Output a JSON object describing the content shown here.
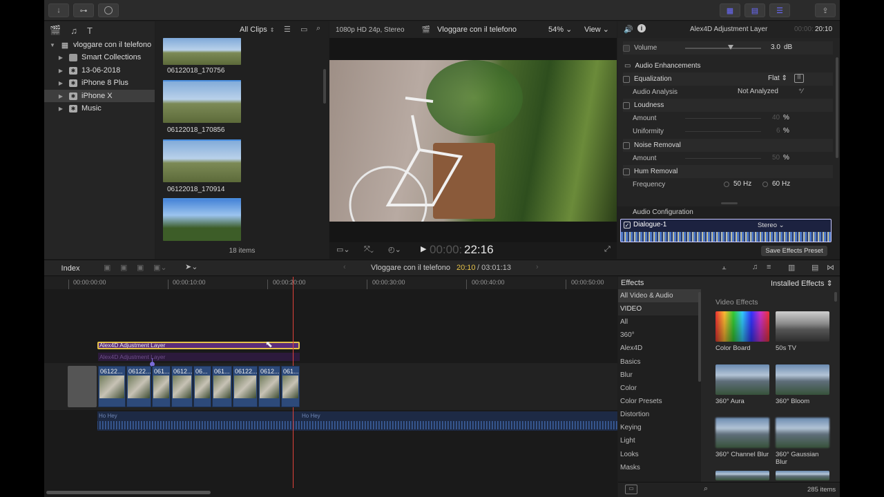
{
  "toolbar": {
    "status": "1080p HD 24p, Stereo",
    "viewer_title": "Vloggare con il telefono",
    "zoom": "54%",
    "view_menu": "View",
    "clip_filter": "All Clips"
  },
  "library": {
    "name": "vloggare con il telefono",
    "items": [
      {
        "label": "Smart Collections"
      },
      {
        "label": "13-06-2018"
      },
      {
        "label": "iPhone 8 Plus"
      },
      {
        "label": "iPhone X"
      },
      {
        "label": "Music"
      }
    ]
  },
  "browser": {
    "clips": [
      {
        "label": "06122018_170756"
      },
      {
        "label": "06122018_170856"
      },
      {
        "label": "06122018_170914"
      }
    ],
    "count": "18 items"
  },
  "viewer": {
    "timecode_dim": "00:00:",
    "timecode": "22:16"
  },
  "inspector": {
    "title": "Alex4D Adjustment Layer",
    "duration_dim": "00:00:",
    "duration": "20:10",
    "volume_label": "Volume",
    "volume_value": "3.0",
    "volume_unit": "dB",
    "audio_enh": "Audio Enhancements",
    "equalization": "Equalization",
    "eq_value": "Flat",
    "audio_analysis": "Audio Analysis",
    "analysis_value": "Not Analyzed",
    "loudness": "Loudness",
    "amount": "Amount",
    "loud_amount": "40",
    "uniformity": "Uniformity",
    "uniformity_value": "6",
    "percent": "%",
    "noise_removal": "Noise Removal",
    "noise_amount": "50",
    "hum_removal": "Hum Removal",
    "frequency": "Frequency",
    "freq_50": "50",
    "freq_60": "60",
    "hz": "Hz",
    "audio_config": "Audio Configuration",
    "channel": "Dialogue-1",
    "channel_mode": "Stereo",
    "save_preset": "Save Effects Preset"
  },
  "timeline": {
    "index": "Index",
    "project": "Vloggare con il telefono",
    "position": "20:10",
    "total": "/ 03:01:13",
    "ruler": [
      "00:00:00:00",
      "00:00:10:00",
      "00:00:20:00",
      "00:00:30:00",
      "00:00:40:00",
      "00:00:50:00"
    ],
    "adj_layer": "Alex4D Adjustment Layer",
    "adj_layer_ghost": "Alex4D Adjustment Layer",
    "clip_names": [
      "06122...",
      "06122...",
      "061...",
      "0612...",
      "06...",
      "061...",
      "06122...",
      "0612...",
      "061..."
    ],
    "audio_names": [
      "Ho Hey",
      "Ho Hey"
    ]
  },
  "effects": {
    "title": "Effects",
    "installed": "Installed Effects",
    "categories": [
      "All Video & Audio",
      "VIDEO",
      "All",
      "360°",
      "Alex4D",
      "Basics",
      "Blur",
      "Color",
      "Color Presets",
      "Distortion",
      "Keying",
      "Light",
      "Looks",
      "Masks"
    ],
    "section": "Video Effects",
    "tiles": [
      {
        "label": "Color Board"
      },
      {
        "label": "50s TV"
      },
      {
        "label": "360° Aura"
      },
      {
        "label": "360° Bloom"
      },
      {
        "label": "360° Channel Blur"
      },
      {
        "label": "360° Gaussian Blur"
      }
    ],
    "count": "285 items"
  },
  "colors": {
    "accent": "#5b5bff",
    "playhead": "#e0433b",
    "selection": "#e6c34a",
    "adjustment": "#5b2d7a"
  }
}
